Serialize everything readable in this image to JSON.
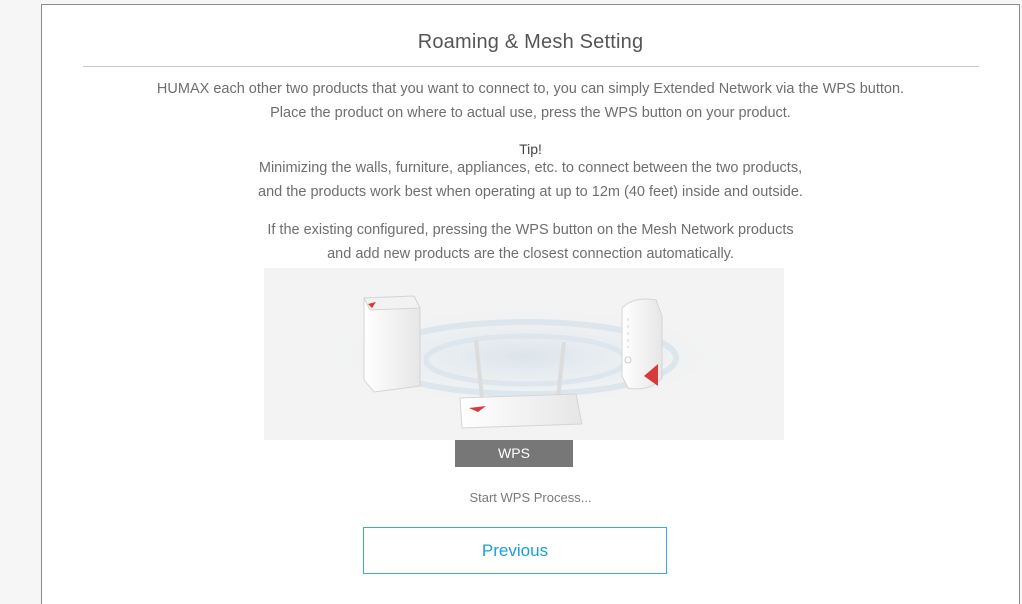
{
  "page": {
    "title": "Roaming & Mesh Setting",
    "description": [
      "HUMAX each other two products that you want to connect to, you can simply Extended Network via the WPS button.",
      "Place the product on where to actual use, press the WPS button on your product."
    ],
    "tip": {
      "label": "Tip!",
      "lines": [
        "Minimizing the walls, furniture, appliances, etc. to connect between the two products,",
        "and the products work best when operating at up to 12m (40 feet) inside and outside."
      ]
    },
    "mesh_note": [
      "If the existing configured, pressing the WPS button on the Mesh Network products",
      "and add new products are the closest connection automatically."
    ],
    "wps_button_label": "WPS",
    "status_text": "Start WPS Process...",
    "previous_button_label": "Previous"
  },
  "colors": {
    "accent": "#1a9fd5",
    "wps_button_bg": "#777777",
    "product_marker": "#d63a3a"
  }
}
